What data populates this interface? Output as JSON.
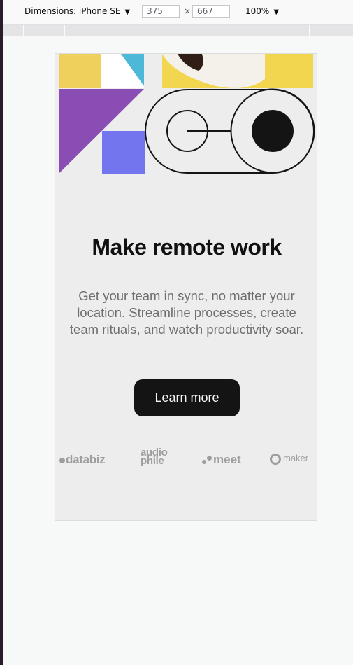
{
  "devtools": {
    "device_label": "Dimensions: iPhone SE",
    "width_value": "375",
    "height_value": "667",
    "times_symbol": "×",
    "zoom_label": "100%"
  },
  "page": {
    "title": "Make remote work",
    "description": "Get your team in sync, no matter your location. Streamline processes, create team rituals, and watch productivity soar.",
    "cta_label": "Learn more",
    "logos": [
      "databiz",
      "audio phile",
      "meet",
      "maker"
    ]
  },
  "colors": {
    "cta_background": "#141414",
    "page_background": "#ededed",
    "text_muted": "#6e6e6e",
    "yellow": "#f0d05c",
    "cyan": "#4db8d8",
    "purple": "#8a4db3",
    "blue": "#7275ee"
  }
}
